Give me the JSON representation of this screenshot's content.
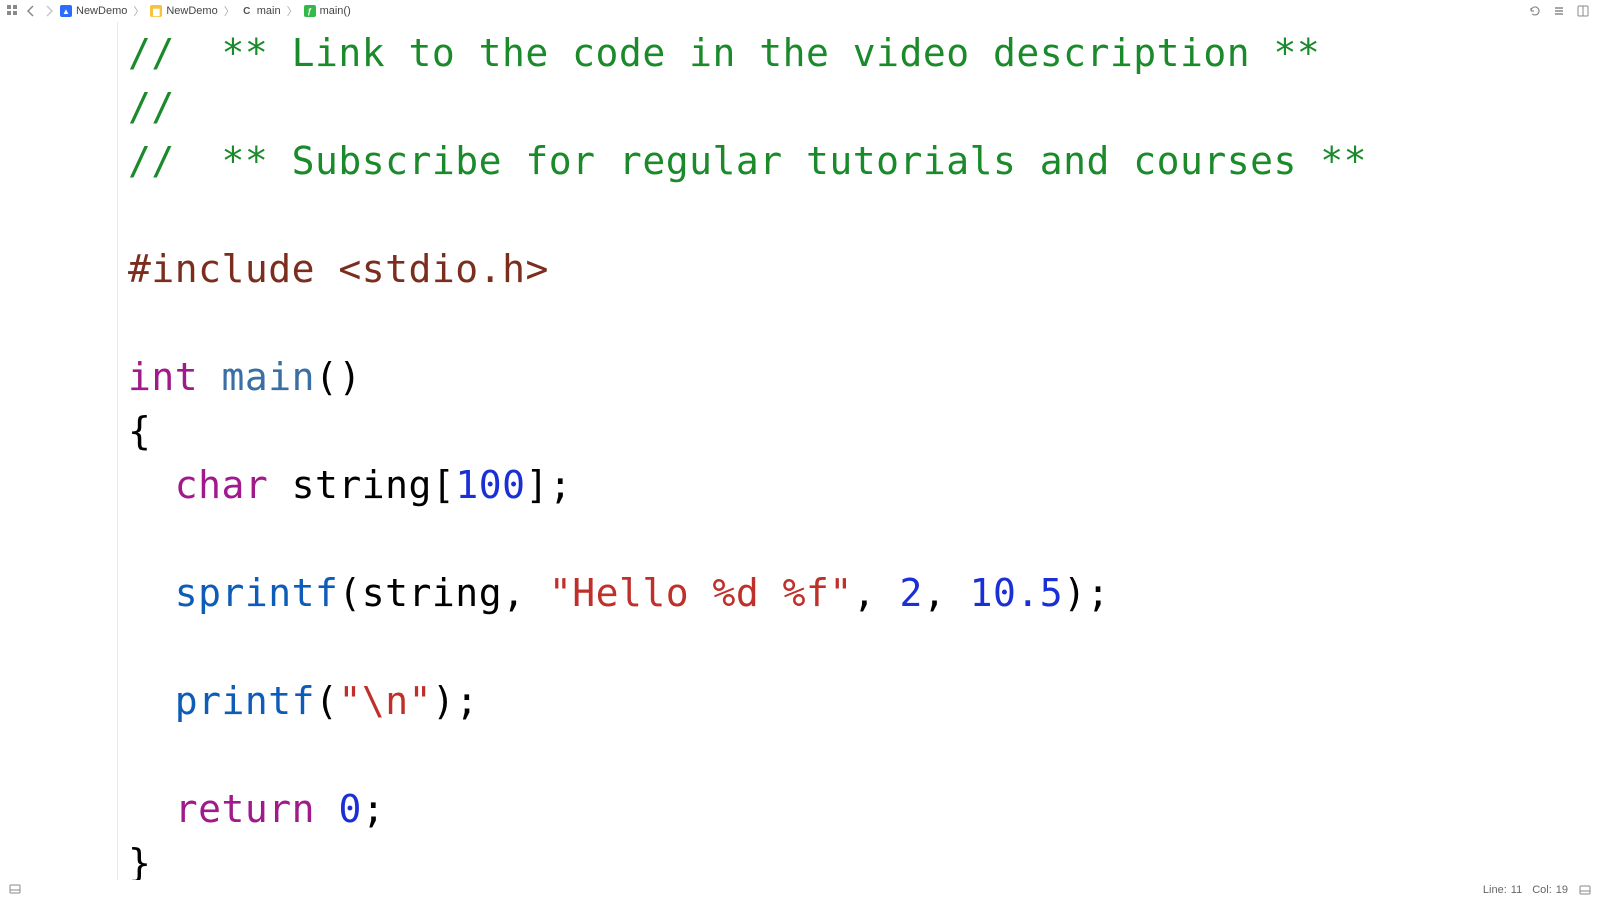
{
  "breadcrumb": {
    "items": [
      {
        "label": "NewDemo"
      },
      {
        "label": "NewDemo"
      },
      {
        "label": "main"
      },
      {
        "label": "main()"
      }
    ]
  },
  "code": {
    "comment1": "//  ** Link to the code in the video description **",
    "comment2": "//",
    "comment3": "//  ** Subscribe for regular tutorials and courses **",
    "include_kw": "#include",
    "include_hdr": "<stdio.h>",
    "int_kw": "int",
    "main_name": "main",
    "main_parens": "()",
    "brace_open": "{",
    "char_kw": "char",
    "string_decl_ident": " string[",
    "string_decl_num": "100",
    "string_decl_end": "];",
    "sprintf_name": "sprintf",
    "sprintf_open": "(string, ",
    "sprintf_str": "\"Hello %d %f\"",
    "sprintf_mid1": ", ",
    "sprintf_arg1": "2",
    "sprintf_mid2": ", ",
    "sprintf_arg2": "10.5",
    "sprintf_close": ");",
    "printf_name": "printf",
    "printf_open": "(",
    "printf_str": "\"\\n\"",
    "printf_close": ");",
    "return_kw": "return",
    "return_sp": " ",
    "return_val": "0",
    "return_end": ";",
    "brace_close": "}"
  },
  "status": {
    "line_label": "Line:",
    "line_value": "11",
    "col_label": "Col:",
    "col_value": "19"
  }
}
